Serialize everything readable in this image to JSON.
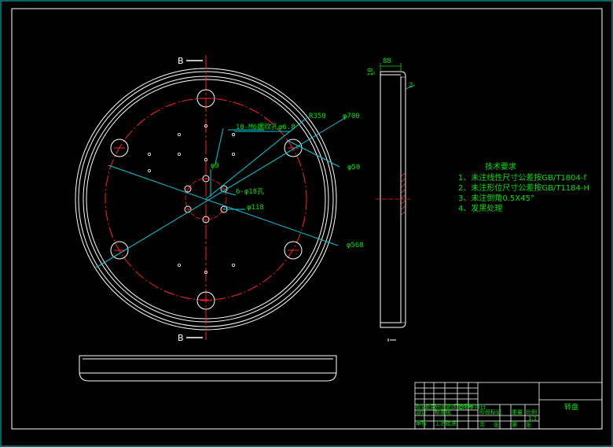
{
  "drawing": {
    "section_labels": {
      "top": "B",
      "bottom": "B"
    },
    "dimensions": {
      "hole_pattern": "10-M6螺纹孔φ6.8",
      "r350": "R350",
      "d700": "φ700",
      "d50": "φ50",
      "d9": "φ9",
      "holes_18": "6-φ18孔",
      "d118": "φ118",
      "d568": "φ568",
      "width88": "88",
      "h10": "10",
      "c2": "2"
    },
    "tech_requirements": {
      "title": "技术要求",
      "items": [
        "1、未注线性尺寸公差按GB/T1804-f",
        "2、未注形位尺寸公差按GB/T1184-H",
        "3、未注倒角0.5X45°",
        "4、发黑处理"
      ]
    },
    "title_block": {
      "part_name": "转盘",
      "ratio": "1:1",
      "cells": [
        "标记",
        "处数",
        "分区",
        "更改文件号",
        "签名",
        "年月日",
        "设计",
        "标准化",
        "阶段标记",
        "重量",
        "比例",
        "审核",
        "工艺",
        "批准",
        "共",
        "张",
        "第",
        "张"
      ]
    },
    "colors": {
      "background": "#000000",
      "outline": "#ffffff",
      "centerline": "#ff2020",
      "dimension": "#00e000",
      "leader": "#00c8d8",
      "frame": "#00c8c8"
    }
  }
}
